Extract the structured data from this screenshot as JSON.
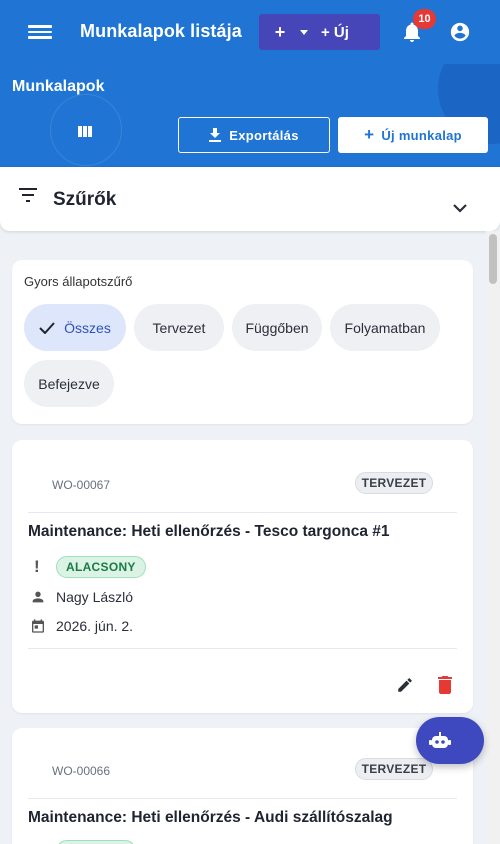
{
  "appbar": {
    "title": "Munkalapok listája",
    "new_plus": "+",
    "new_label": "+ Új",
    "notification_count": "10",
    "icons": [
      "menu-icon",
      "bell-icon",
      "account-circle-icon",
      "chevron-down-icon"
    ]
  },
  "hero": {
    "title": "Munkalapok",
    "export_label": "Exportálás",
    "new_work_order_label": "Új munkalap",
    "new_work_order_plus": "+"
  },
  "filters": {
    "title": "Szűrők"
  },
  "status_filter": {
    "label": "Gyors állapotszűrő",
    "chips": [
      {
        "label": "Összes",
        "selected": true
      },
      {
        "label": "Tervezet",
        "selected": false
      },
      {
        "label": "Függőben",
        "selected": false
      },
      {
        "label": "Folyamatban",
        "selected": false
      },
      {
        "label": "Befejezve",
        "selected": false
      }
    ]
  },
  "work_orders": [
    {
      "id": "WO-00067",
      "status": "TERVEZET",
      "title": "Maintenance: Heti ellenőrzés - Tesco targonca #1",
      "priority_mark": "!",
      "priority": "ALACSONY",
      "assignee": "Nagy László",
      "date": "2026. jún. 2."
    },
    {
      "id": "WO-00066",
      "status": "TERVEZET",
      "title": "Maintenance: Heti ellenőrzés - Audi szállítószalag"
    }
  ],
  "colors": {
    "primary": "#1f74d4",
    "split_button": "#4646b8",
    "badge": "#e53935",
    "priority_low_bg": "#daf3e4",
    "priority_low_text": "#1c7a47",
    "delete": "#e53935",
    "fab": "#3f49bf"
  }
}
